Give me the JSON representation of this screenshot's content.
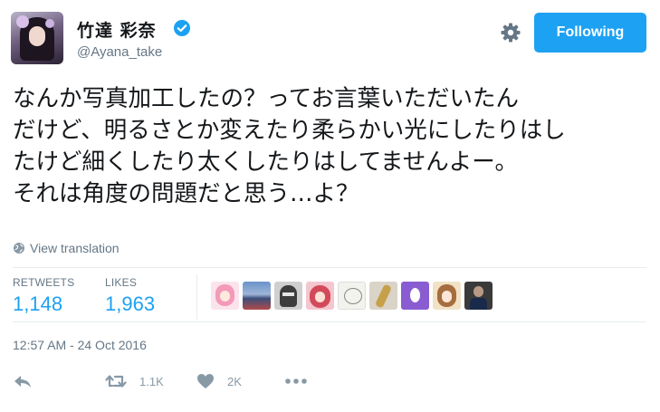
{
  "user": {
    "display_name": "竹達 彩奈",
    "username": "@Ayana_take"
  },
  "header": {
    "follow_label": "Following"
  },
  "tweet": {
    "lines": [
      "なんか写真加工したの？ってお言葉いただいたん",
      "だけど、明るさとか変えたり柔らかい光にしたりはし",
      "たけど細くしたり太くしたりはしてませんよー。",
      "それは角度の問題だと思う…よ？"
    ],
    "translate_label": "View translation"
  },
  "stats": {
    "retweets_label": "RETWEETS",
    "retweets_value": "1,148",
    "likes_label": "LIKES",
    "likes_value": "1,963"
  },
  "liker_avatars": [
    "avatar-pink-anime-girl",
    "avatar-landscape-sky",
    "avatar-bw-helmet",
    "avatar-red-anime-girl",
    "avatar-sketch",
    "avatar-guitar",
    "avatar-default-egg",
    "avatar-brown-hair-anime",
    "avatar-dark-photo"
  ],
  "timestamp": "12:57 AM - 24 Oct 2016",
  "actions": {
    "retweet_count": "1.1K",
    "like_count": "2K"
  },
  "colors": {
    "accent": "#1da1f2",
    "muted": "#657786",
    "icon": "#8899a6",
    "divider": "#e6ecf0",
    "egg_avatar": "#8a5cd1"
  },
  "icons": {
    "verified": "verified-badge-icon",
    "settings": "gear-icon",
    "translate": "globe-icon",
    "reply": "reply-icon",
    "retweet": "retweet-icon",
    "like": "heart-icon",
    "more": "more-dots-icon"
  }
}
